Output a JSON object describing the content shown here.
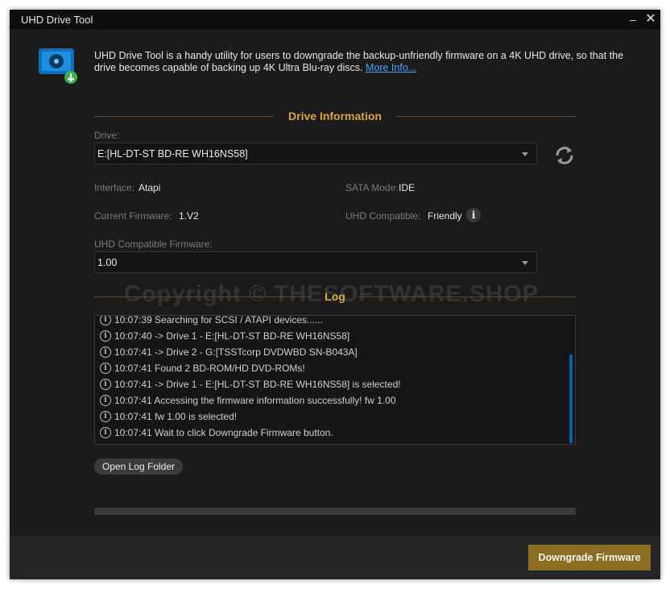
{
  "window": {
    "title": "UHD Drive Tool"
  },
  "intro": {
    "text": "UHD Drive Tool is a handy utility for users to downgrade the backup-unfriendly firmware on a 4K UHD drive, so that the drive becomes capable of backing up 4K Ultra Blu-ray discs.",
    "link": "More Info..."
  },
  "drive_info": {
    "heading": "Drive Information",
    "drive_label": "Drive:",
    "drive_value": "E:[HL-DT-ST BD-RE  WH16NS58]",
    "interface_label": "Interface:",
    "interface_value": "Atapi",
    "sata_label": "SATA Mode:",
    "sata_value": "IDE",
    "firmware_label": "Current Firmware:",
    "firmware_value": "1.V2",
    "compatible_label": "UHD Compatible:",
    "compatible_value": "Friendly",
    "uhd_fw_label": "UHD Compatible Firmware:",
    "uhd_fw_value": "1.00"
  },
  "watermark": "Copyright © THESOFTWARE.SHOP",
  "log": {
    "heading": "Log",
    "lines": [
      "10:07:39 Searching for SCSI / ATAPI devices......",
      "10:07:40 -> Drive 1 - E:[HL-DT-ST BD-RE WH16NS58]",
      "10:07:41 -> Drive 2 - G:[TSSTcorp DVDWBD SN-B043A]",
      "10:07:41 Found 2 BD-ROM/HD DVD-ROMs!",
      "10:07:41 -> Drive 1 - E:[HL-DT-ST BD-RE WH16NS58] is selected!",
      "10:07:41 Accessing the firmware information successfully! fw 1.00",
      "10:07:41 fw 1.00 is selected!",
      "10:07:41 Wait to click Downgrade Firmware button."
    ],
    "open_folder": "Open Log Folder"
  },
  "footer": {
    "primary_button": "Downgrade Firmware"
  },
  "colors": {
    "accent": "#d9a53f",
    "button": "#8a6c22",
    "link": "#4aa3ff",
    "background": "#1b1b1b"
  },
  "icons": {
    "app": "disc-download-icon",
    "refresh": "refresh-icon",
    "info": "info-icon"
  }
}
